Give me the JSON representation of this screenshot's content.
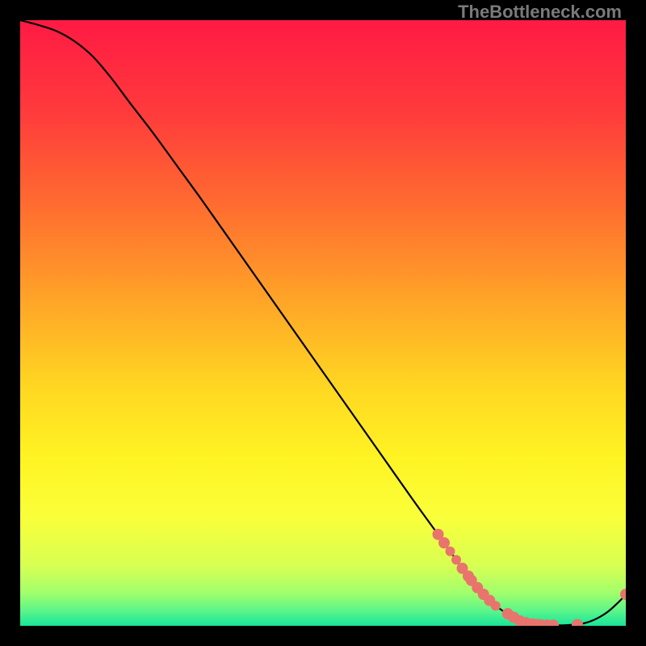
{
  "watermark": "TheBottleneck.com",
  "chart_data": {
    "type": "line",
    "title": "",
    "xlabel": "",
    "ylabel": "",
    "xlim": [
      0,
      100
    ],
    "ylim": [
      0,
      100
    ],
    "grid": false,
    "legend": false,
    "gradient_stops": [
      {
        "pos": 0.0,
        "color": "#ff1a44"
      },
      {
        "pos": 0.15,
        "color": "#ff3a3c"
      },
      {
        "pos": 0.3,
        "color": "#ff6a30"
      },
      {
        "pos": 0.45,
        "color": "#ffa028"
      },
      {
        "pos": 0.6,
        "color": "#ffd522"
      },
      {
        "pos": 0.72,
        "color": "#fff323"
      },
      {
        "pos": 0.82,
        "color": "#faff3a"
      },
      {
        "pos": 0.9,
        "color": "#d8ff52"
      },
      {
        "pos": 0.945,
        "color": "#a3ff6c"
      },
      {
        "pos": 0.975,
        "color": "#5cf58a"
      },
      {
        "pos": 1.0,
        "color": "#18e59a"
      }
    ],
    "series": [
      {
        "name": "bottleneck-curve",
        "color": "#000000",
        "x": [
          0,
          3,
          6,
          9,
          12,
          15,
          18,
          22,
          26,
          30,
          35,
          40,
          45,
          50,
          55,
          60,
          65,
          70,
          74,
          78,
          81,
          83,
          85,
          87,
          90,
          93,
          95,
          97,
          99,
          100
        ],
        "y": [
          100,
          99.2,
          98.2,
          96.5,
          94.0,
          90.5,
          86.5,
          81.3,
          75.8,
          70.3,
          63.2,
          56.1,
          49.0,
          41.9,
          34.8,
          27.7,
          20.6,
          13.7,
          8.2,
          3.8,
          1.6,
          0.6,
          0.2,
          0.1,
          0.1,
          0.4,
          1.1,
          2.3,
          4.1,
          5.2
        ]
      },
      {
        "name": "highlight-markers",
        "color": "#e9746d",
        "marker_radius": [
          7,
          7,
          6,
          6,
          7,
          7,
          7,
          7,
          7,
          7,
          6,
          7,
          7,
          7,
          7,
          7,
          7,
          7,
          7,
          6,
          7,
          7,
          7,
          7
        ],
        "x": [
          69.0,
          70.0,
          71.0,
          72.0,
          73.0,
          74.0,
          74.5,
          75.5,
          76.5,
          77.5,
          78.5,
          80.5,
          81.5,
          82.5,
          83.5,
          84.5,
          85.0,
          85.5,
          86.0,
          86.5,
          87.0,
          88.0,
          92.0,
          100.0
        ],
        "y": [
          15.1,
          13.7,
          12.3,
          10.9,
          9.5,
          8.2,
          7.5,
          6.3,
          5.2,
          4.2,
          3.3,
          2.0,
          1.4,
          0.8,
          0.5,
          0.3,
          0.2,
          0.2,
          0.15,
          0.12,
          0.1,
          0.1,
          0.2,
          5.2
        ]
      }
    ]
  }
}
